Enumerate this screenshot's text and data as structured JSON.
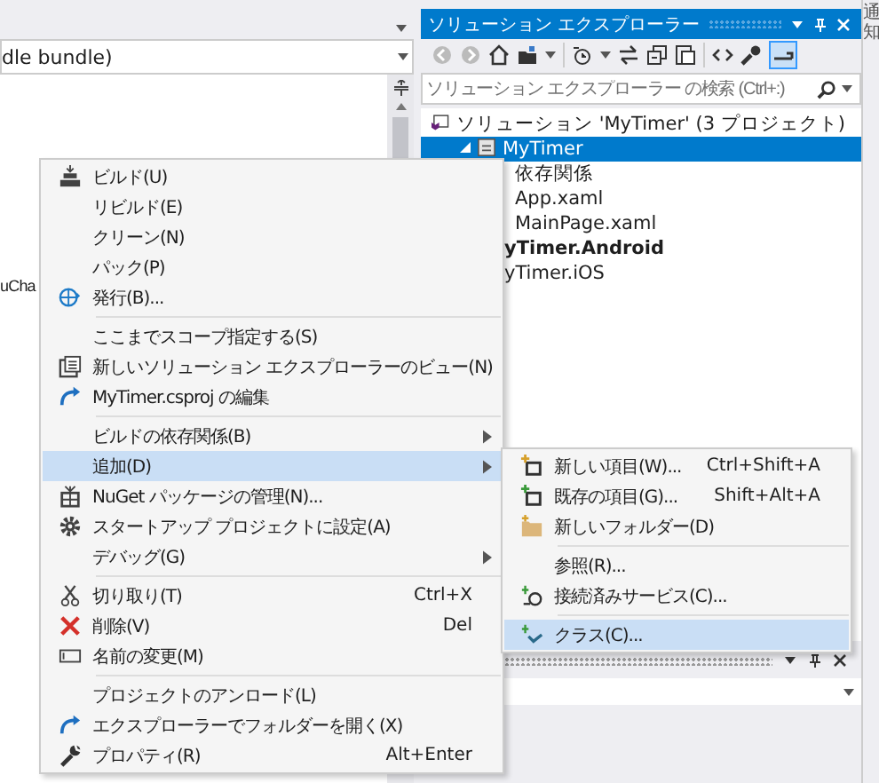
{
  "notification_tab": {
    "label": "通知"
  },
  "editor": {
    "dropdown": {
      "value": "dle bundle)"
    },
    "code_fragment": "uCha"
  },
  "solution_explorer": {
    "title": "ソリューション エクスプローラー",
    "search": {
      "placeholder": "ソリューション エクスプローラー の検索 (Ctrl+:)"
    },
    "tree": [
      {
        "label": "ソリューション 'MyTimer' (3 プロジェクト)",
        "kind": "solution",
        "selected": false,
        "startup": false,
        "children": [
          {
            "label": "MyTimer",
            "kind": "project",
            "selected": true,
            "startup": false,
            "expanded": true,
            "children": [
              {
                "label": "依存関係",
                "selected": false,
                "startup": false
              },
              {
                "label": "App.xaml",
                "selected": false,
                "startup": false
              },
              {
                "label": "MainPage.xaml",
                "selected": false,
                "startup": false
              }
            ]
          },
          {
            "label": "yTimer.Android",
            "selected": false,
            "startup": true
          },
          {
            "label": "yTimer.iOS",
            "selected": false,
            "startup": false
          }
        ]
      }
    ]
  },
  "context_menu": {
    "groups": [
      [
        {
          "label": "ビルド(U)",
          "selected": false
        },
        {
          "label": "リビルド(E)",
          "selected": false
        },
        {
          "label": "クリーン(N)",
          "selected": false
        },
        {
          "label": "パック(P)",
          "selected": false
        },
        {
          "label": "発行(B)...",
          "selected": false
        }
      ],
      [
        {
          "label": "ここまでスコープ指定する(S)",
          "selected": false
        },
        {
          "label": "新しいソリューション エクスプローラーのビュー(N)",
          "selected": false
        },
        {
          "label": "MyTimer.csproj の編集",
          "selected": false
        }
      ],
      [
        {
          "label": "ビルドの依存関係(B)",
          "submenu": true,
          "selected": false
        },
        {
          "label": "追加(D)",
          "submenu": true,
          "selected": true
        },
        {
          "label": "NuGet パッケージの管理(N)...",
          "selected": false
        },
        {
          "label": "スタートアップ プロジェクトに設定(A)",
          "selected": false
        },
        {
          "label": "デバッグ(G)",
          "submenu": true,
          "selected": false
        }
      ],
      [
        {
          "label": "切り取り(T)",
          "shortcut": "Ctrl+X",
          "selected": false
        },
        {
          "label": "削除(V)",
          "shortcut": "Del",
          "selected": false
        },
        {
          "label": "名前の変更(M)",
          "selected": false
        }
      ],
      [
        {
          "label": "プロジェクトのアンロード(L)",
          "selected": false
        },
        {
          "label": "エクスプローラーでフォルダーを開く(X)",
          "selected": false
        },
        {
          "label": "プロパティ(R)",
          "shortcut": "Alt+Enter",
          "selected": false
        }
      ]
    ]
  },
  "add_submenu": {
    "groups": [
      [
        {
          "label": "新しい項目(W)...",
          "shortcut": "Ctrl+Shift+A",
          "selected": false
        },
        {
          "label": "既存の項目(G)...",
          "shortcut": "Shift+Alt+A",
          "selected": false
        },
        {
          "label": "新しいフォルダー(D)",
          "selected": false
        }
      ],
      [
        {
          "label": "参照(R)...",
          "selected": false
        },
        {
          "label": "接続済みサービス(C)...",
          "selected": false
        }
      ],
      [
        {
          "label": "クラス(C)...",
          "selected": true
        }
      ]
    ]
  }
}
